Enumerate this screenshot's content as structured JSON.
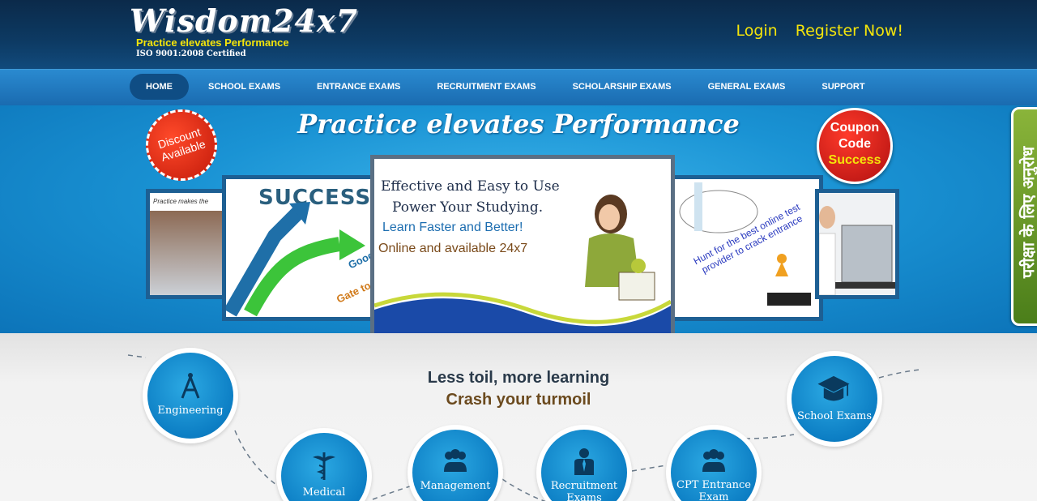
{
  "header": {
    "brand": "Wisdom24x7",
    "tagline": "Practice elevates Performance",
    "certification": "ISO 9001:2008 Certified",
    "login": "Login",
    "register": "Register Now!"
  },
  "nav": {
    "items": [
      {
        "label": "HOME",
        "active": true
      },
      {
        "label": "SCHOOL EXAMS"
      },
      {
        "label": "ENTRANCE EXAMS"
      },
      {
        "label": "RECRUITMENT EXAMS"
      },
      {
        "label": "SCHOLARSHIP EXAMS"
      },
      {
        "label": "GENERAL EXAMS"
      },
      {
        "label": "SUPPORT"
      }
    ]
  },
  "banner": {
    "title": "Practice elevates Performance",
    "discount_line1": "Discount",
    "discount_line2": "Available",
    "coupon_line1": "Coupon",
    "coupon_line2": "Code",
    "coupon_line3": "Success",
    "slide1_caption": "Practice makes the",
    "slide2_word": "SUCCESS",
    "slide2_good": "Good",
    "slide2_gate": "Gate to",
    "slide3_line1": "Effective and Easy to Use",
    "slide3_line2": "Power Your Studying.",
    "slide3_line3": "Learn Faster and Better!",
    "slide3_line4": "Online and available 24x7",
    "slide4_text": "Hunt for the best online test provider to crack entrance",
    "side_tab": "परीक्षा के लिए अनुरोध"
  },
  "lower": {
    "tagline1": "Less toil, more learning",
    "tagline2": "Crash your turmoil",
    "categories": {
      "engineering": "Engineering",
      "medical": "Medical",
      "management": "Management",
      "recruitment": "Recruitment Exams",
      "cpt": "CPT Entrance Exam",
      "school": "School Exams"
    }
  },
  "colors": {
    "accent_yellow": "#f5e50a",
    "header_navy": "#0d3a63",
    "nav_blue": "#1a6bb0",
    "circle_blue": "#0c7ec4"
  }
}
